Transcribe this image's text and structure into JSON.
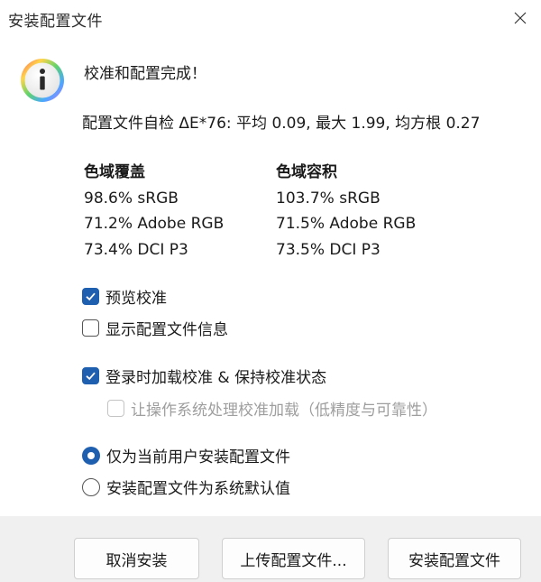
{
  "window": {
    "title": "安装配置文件"
  },
  "message": {
    "heading": "校准和配置完成！",
    "self_check": "配置文件自检 ΔE*76: 平均 0.09, 最大 1.99, 均方根 0.27"
  },
  "gamut_coverage": {
    "header": "色域覆盖",
    "items": [
      "98.6% sRGB",
      "71.2% Adobe RGB",
      "73.4% DCI P3"
    ]
  },
  "gamut_volume": {
    "header": "色域容积",
    "items": [
      "103.7% sRGB",
      "71.5% Adobe RGB",
      "73.5% DCI P3"
    ]
  },
  "options": {
    "preview_calibration": {
      "label": "预览校准",
      "checked": true
    },
    "show_profile_info": {
      "label": "显示配置文件信息",
      "checked": false
    },
    "load_on_login": {
      "label": "登录时加载校准 & 保持校准状态",
      "checked": true
    },
    "os_handles_loading": {
      "label": "让操作系统处理校准加载（低精度与可靠性）",
      "checked": false,
      "disabled": true
    }
  },
  "install_scope": {
    "current_user": {
      "label": "仅为当前用户安装配置文件",
      "selected": true
    },
    "system_default": {
      "label": "安装配置文件为系统默认值",
      "selected": false
    }
  },
  "buttons": {
    "cancel": "取消安装",
    "upload": "上传配置文件...",
    "install": "安装配置文件"
  },
  "colors": {
    "accent": "#1f5fb0",
    "footer": "#f0f0f0"
  },
  "icons": {
    "info": "info-icon",
    "close": "close-icon"
  }
}
